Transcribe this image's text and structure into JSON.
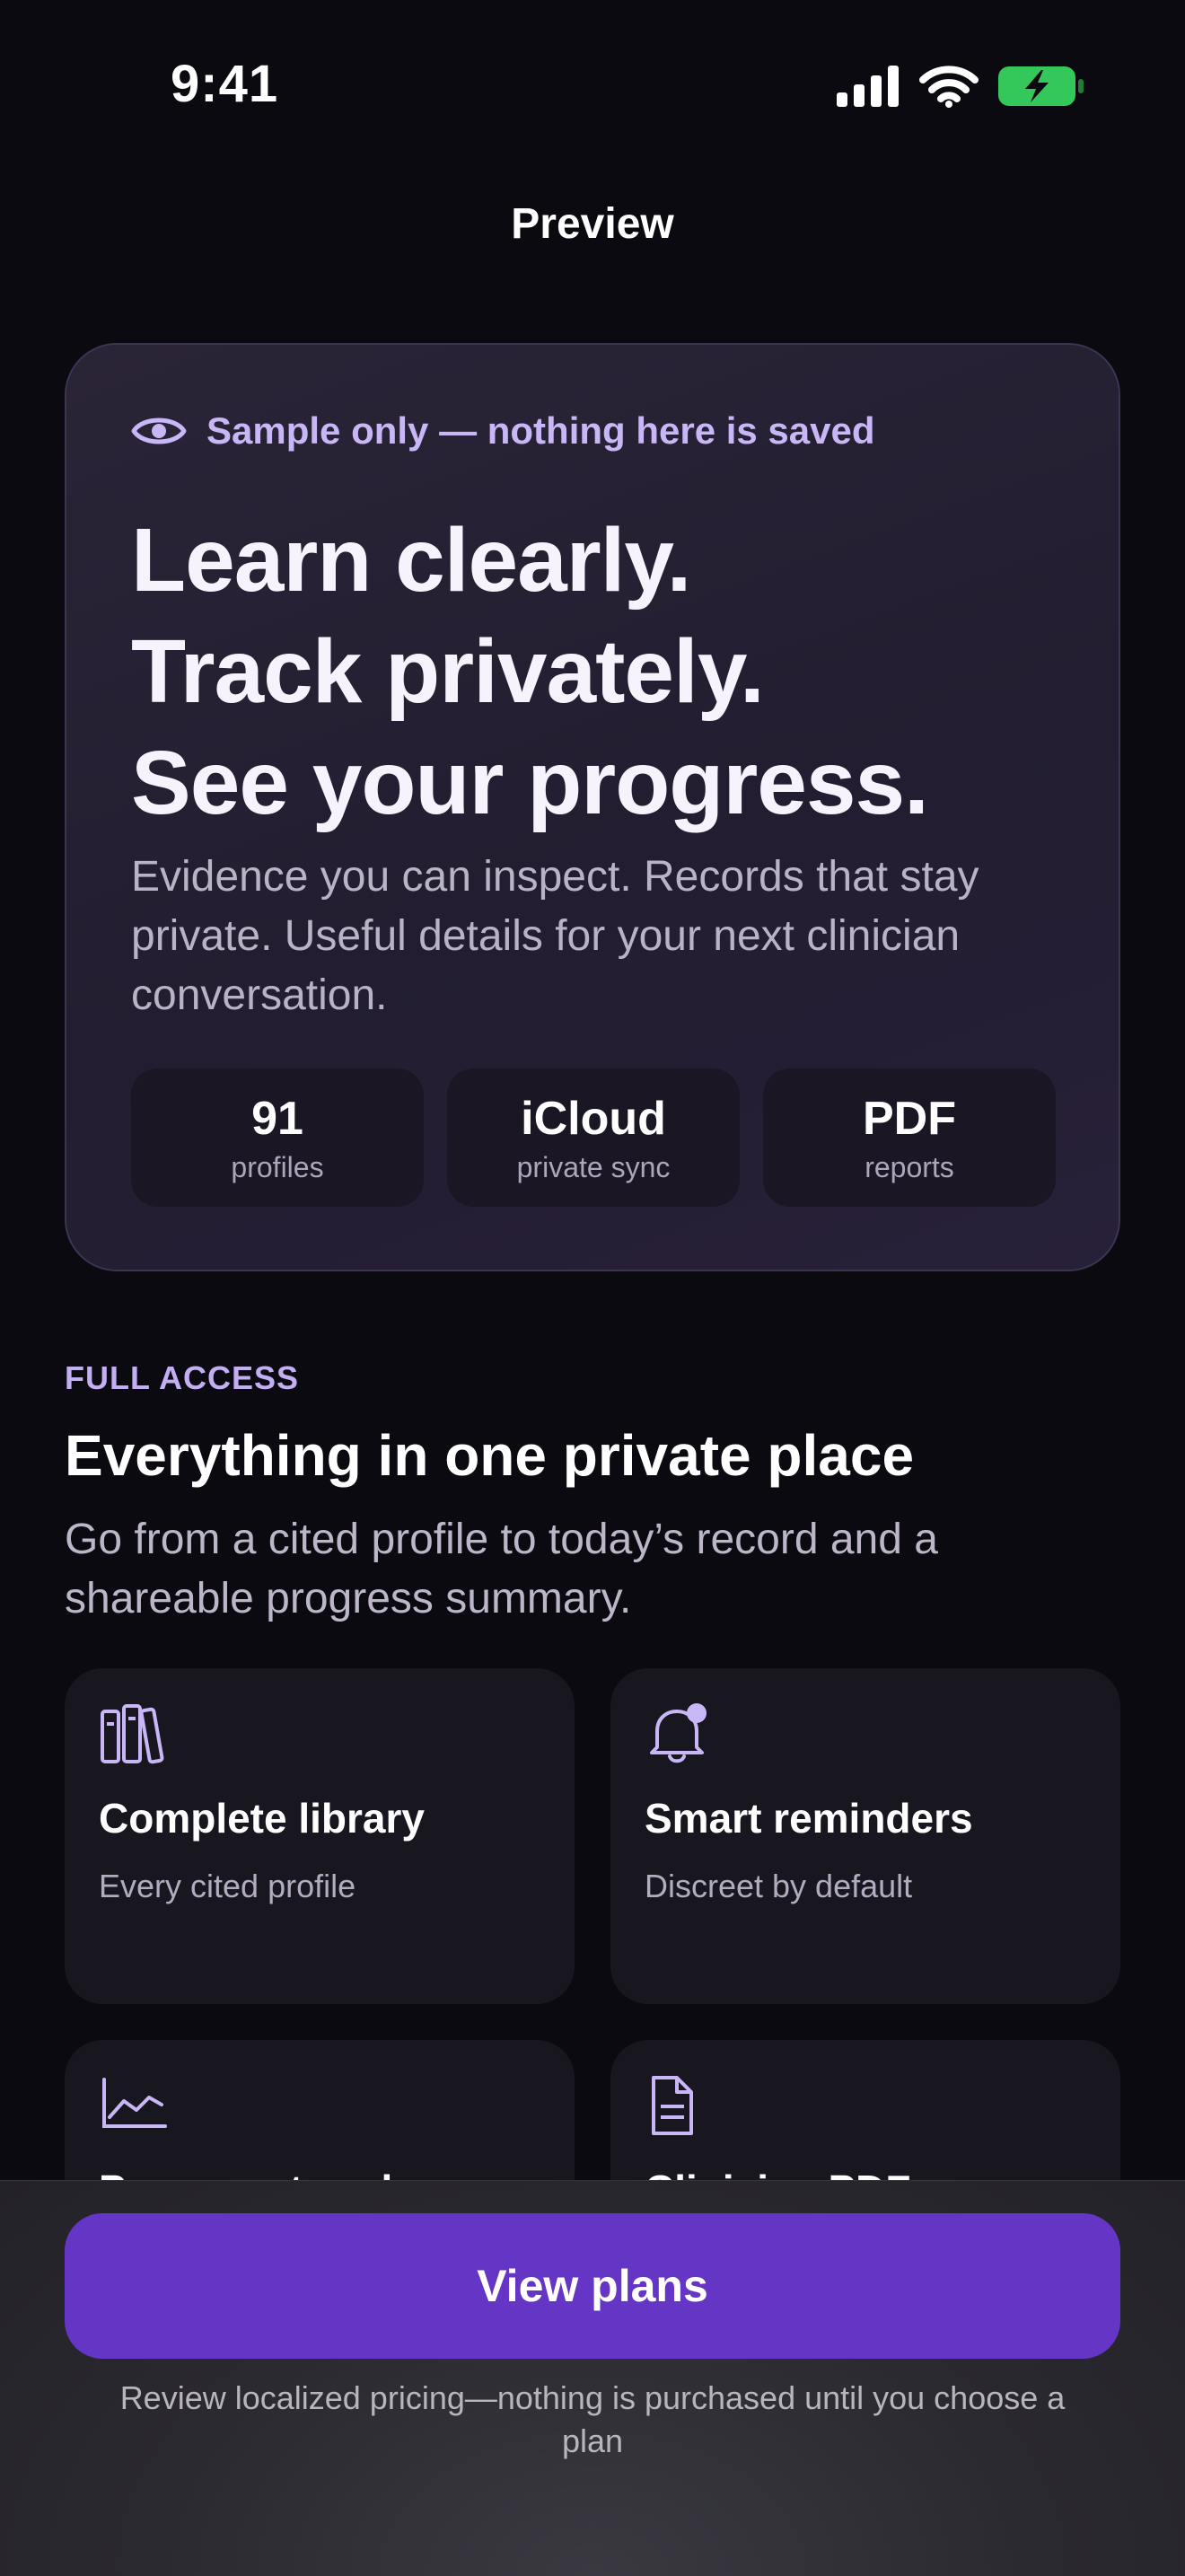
{
  "status_bar": {
    "time": "9:41"
  },
  "nav": {
    "title": "Preview"
  },
  "hero": {
    "sample_notice": "Sample only — nothing here is saved",
    "title_lines": [
      "Learn clearly.",
      "Track privately.",
      "See your progress."
    ],
    "subtitle": "Evidence you can inspect. Records that stay private. Useful details for your next clinician conversation.",
    "stats": [
      {
        "value": "91",
        "label": "profiles"
      },
      {
        "value": "iCloud",
        "label": "private sync"
      },
      {
        "value": "PDF",
        "label": "reports"
      }
    ]
  },
  "section": {
    "eyebrow": "FULL ACCESS",
    "title": "Everything in one private place",
    "subtitle": "Go from a cited profile to today’s record and a shareable progress summary."
  },
  "features": [
    {
      "title": "Complete library",
      "subtitle": "Every cited profile",
      "icon": "library-icon"
    },
    {
      "title": "Smart reminders",
      "subtitle": "Discreet by default",
      "icon": "bell-badge-icon"
    },
    {
      "title": "Progress trends",
      "subtitle": "",
      "icon": "chart-line-icon"
    },
    {
      "title": "Clinician PDF",
      "subtitle": "",
      "icon": "document-icon"
    }
  ],
  "cta": {
    "label": "View plans",
    "note": "Review localized pricing—nothing is purchased until you choose a plan"
  },
  "colors": {
    "accent": "#6535c5",
    "accent_light": "#c9b6f6",
    "background": "#0b0a10",
    "battery": "#34c759"
  }
}
